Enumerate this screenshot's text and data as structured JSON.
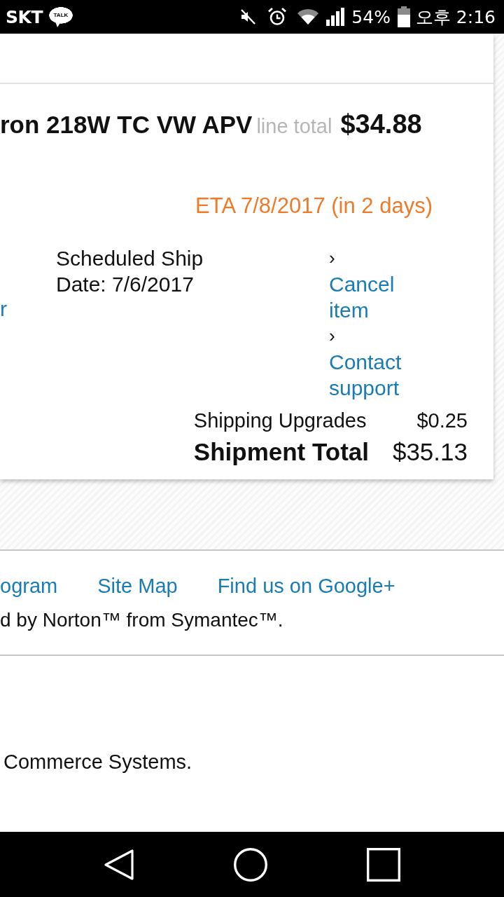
{
  "status_bar": {
    "carrier": "SKT",
    "chat_badge": "TALK",
    "battery": "54%",
    "time": "오후 2:16"
  },
  "order_item": {
    "product_name": "ron 218W TC VW APV",
    "line_total_label": "line total",
    "line_total": "$34.88",
    "eta": "ETA 7/8/2017 (in 2 days)",
    "side_link": "r",
    "ship_date": "Scheduled Ship Date: 7/6/2017",
    "actions": [
      {
        "chevron": "›",
        "label": "Cancel item"
      },
      {
        "chevron": "›",
        "label": "Contact support"
      }
    ],
    "summary": [
      {
        "kind": "line",
        "label": "Shipping Upgrades",
        "amount": "$0.25"
      },
      {
        "kind": "total",
        "label": "Shipment Total",
        "amount": "$35.13"
      }
    ]
  },
  "footer": {
    "links": [
      "ogram",
      "Site Map",
      "Find us on Google+"
    ],
    "security_note": "d by Norton™ from Symantec™."
  },
  "copyright": "Commerce Systems."
}
